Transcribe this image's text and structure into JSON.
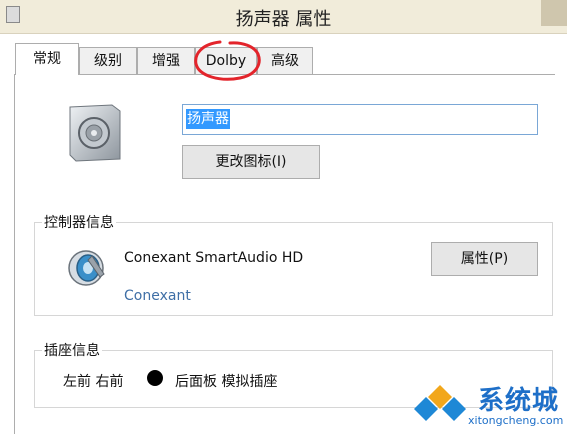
{
  "window": {
    "title": "扬声器 属性"
  },
  "tabs": [
    {
      "label": "常规",
      "active": true
    },
    {
      "label": "级别"
    },
    {
      "label": "增强"
    },
    {
      "label": "Dolby"
    },
    {
      "label": "高级"
    }
  ],
  "general": {
    "device_name_value": "扬声器",
    "change_icon_label": "更改图标(I)"
  },
  "controller": {
    "group_label": "控制器信息",
    "name": "Conexant SmartAudio HD",
    "vendor_link": "Conexant",
    "properties_label": "属性(P)"
  },
  "jack": {
    "group_label": "插座信息",
    "position": "左前 右前",
    "jack_color": "#000000",
    "location": "后面板 模拟插座"
  },
  "watermark": {
    "brand": "系统城",
    "url": "xitongcheng.com"
  },
  "colors": {
    "titlebar": "#f1ecda",
    "selection": "#3399ff",
    "link": "#3f6fa6",
    "annotation_circle": "#e3242b",
    "watermark": "#1e6fc8"
  }
}
